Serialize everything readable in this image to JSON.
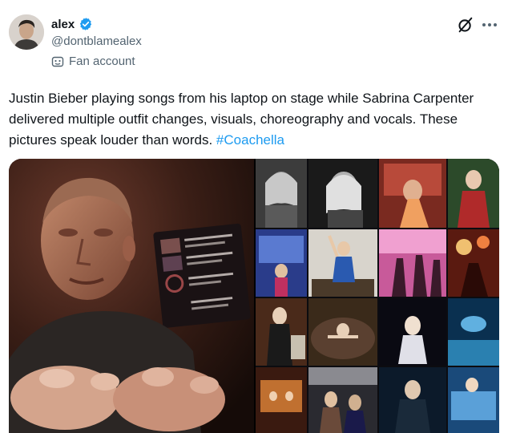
{
  "author": {
    "display_name": "alex",
    "handle": "@dontblamealex",
    "account_label": "Fan account",
    "verified": true
  },
  "tweet": {
    "text": "Justin Bieber playing songs from his laptop on stage while Sabrina Carpenter delivered multiple outfit changes, visuals, choreography and vocals. These pictures speak louder than words. ",
    "hashtag": "#Coachella"
  },
  "icons": {
    "verified": "verified-badge-icon",
    "label": "fan-account-mask-icon",
    "grok": "grok-icon",
    "more": "more-options-icon"
  },
  "colors": {
    "link": "#1d9bf0",
    "secondary_text": "#536471",
    "verified": "#1d9bf0"
  },
  "media": {
    "photos": [
      "Justin Bieber performing with laptop on stage",
      "Collage of Sabrina Carpenter performance photos"
    ]
  }
}
